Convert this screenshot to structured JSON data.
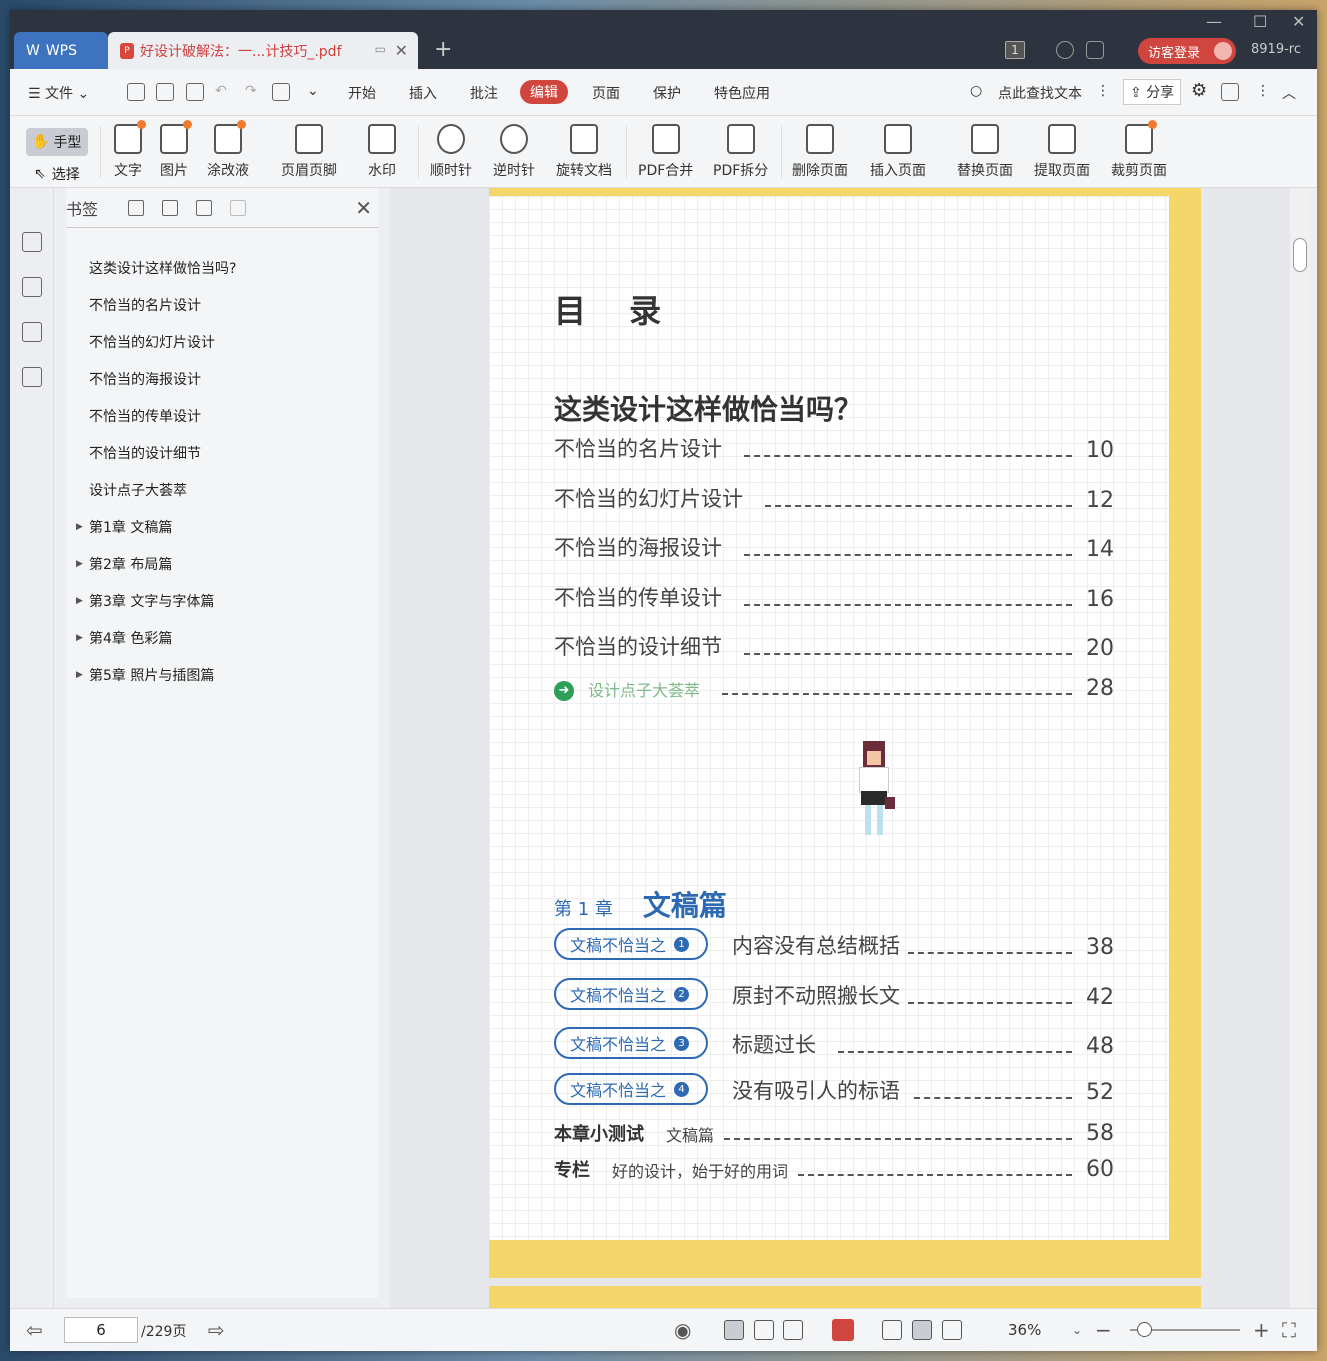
{
  "titlebar": {
    "wps_tab": "WPS",
    "doc_tab": "好设计破解法：一...计技巧_.pdf",
    "new_tab": "+",
    "page_badge": "1",
    "login": "访客登录",
    "user": "8919-rc"
  },
  "menubar": {
    "file": "文件",
    "items": [
      "开始",
      "插入",
      "批注",
      "编辑",
      "页面",
      "保护",
      "特色应用"
    ],
    "active": "编辑",
    "search": "点此查找文本",
    "share": "分享"
  },
  "toolbar": {
    "hand": "手型",
    "select": "选择",
    "buttons": [
      "文字",
      "图片",
      "涂改液",
      "页眉页脚",
      "水印",
      "顺时针",
      "逆时针",
      "旋转文档",
      "PDF合并",
      "PDF拆分",
      "删除页面",
      "插入页面",
      "替换页面",
      "提取页面",
      "裁剪页面"
    ]
  },
  "bookmarks": {
    "title": "书签",
    "items": [
      "这类设计这样做恰当吗?",
      "不恰当的名片设计",
      "不恰当的幻灯片设计",
      "不恰当的海报设计",
      "不恰当的传单设计",
      "不恰当的设计细节",
      "设计点子大荟萃",
      "第1章  文稿篇",
      "第2章  布局篇",
      "第3章  文字与字体篇",
      "第4章  色彩篇",
      "第5章  照片与插图篇"
    ]
  },
  "page": {
    "title": "目 录",
    "section": "这类设计这样做恰当吗？",
    "rows": [
      {
        "label": "不恰当的名片设计",
        "num": "10"
      },
      {
        "label": "不恰当的幻灯片设计",
        "num": "12"
      },
      {
        "label": "不恰当的海报设计",
        "num": "14"
      },
      {
        "label": "不恰当的传单设计",
        "num": "16"
      },
      {
        "label": "不恰当的设计细节",
        "num": "20"
      }
    ],
    "highlight": {
      "label": "设计点子大荟萃",
      "num": "28"
    },
    "chapter": {
      "prefix": "第 1 章",
      "name": "文稿篇"
    },
    "chapter_rows": [
      {
        "pill": "文稿不恰当之",
        "n": "1",
        "label": "内容没有总结概括",
        "num": "38"
      },
      {
        "pill": "文稿不恰当之",
        "n": "2",
        "label": "原封不动照搬长文",
        "num": "42"
      },
      {
        "pill": "文稿不恰当之",
        "n": "3",
        "label": "标题过长",
        "num": "48"
      },
      {
        "pill": "文稿不恰当之",
        "n": "4",
        "label": "没有吸引人的标语",
        "num": "52"
      }
    ],
    "quiz": {
      "k": "本章小测试",
      "s": "文稿篇",
      "num": "58"
    },
    "column": {
      "k": "专栏",
      "s": "好的设计，始于好的用词",
      "num": "60"
    }
  },
  "status": {
    "page_input": "6",
    "total": "/229页",
    "zoom": "36%"
  }
}
